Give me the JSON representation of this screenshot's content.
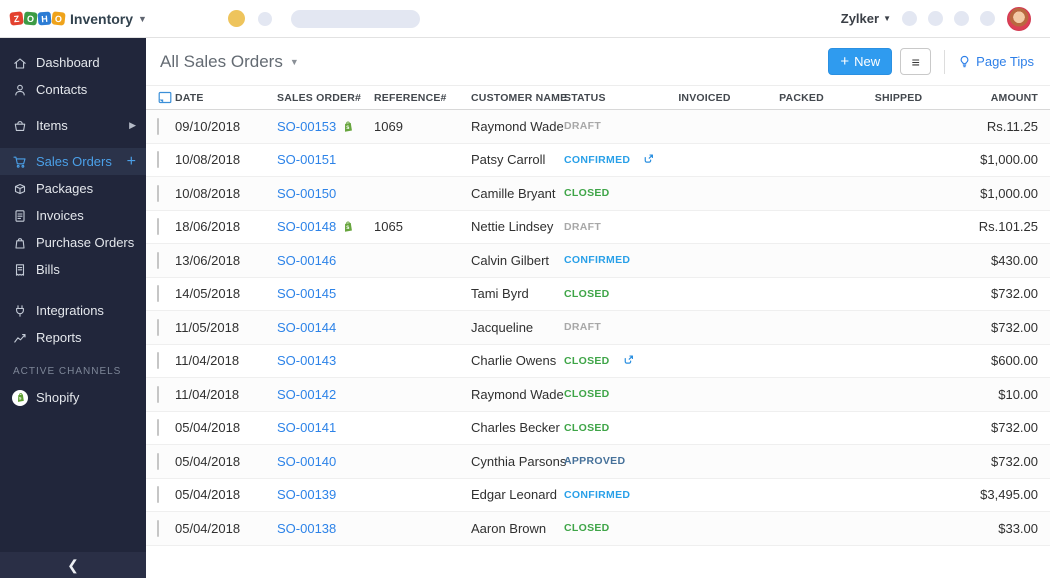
{
  "topbar": {
    "logo_letters": [
      "Z",
      "O",
      "H",
      "O"
    ],
    "logo_colors": [
      "#E3412F",
      "#3D9B45",
      "#2C7CD4",
      "#EFA31B"
    ],
    "product_name": "Inventory",
    "org_name": "Zylker"
  },
  "sidebar": {
    "items": [
      {
        "label": "Dashboard"
      },
      {
        "label": "Contacts"
      },
      {
        "label": "Items"
      },
      {
        "label": "Sales Orders"
      },
      {
        "label": "Packages"
      },
      {
        "label": "Invoices"
      },
      {
        "label": "Purchase Orders"
      },
      {
        "label": "Bills"
      },
      {
        "label": "Integrations"
      },
      {
        "label": "Reports"
      }
    ],
    "section_label": "ACTIVE CHANNELS",
    "channels": [
      {
        "label": "Shopify"
      }
    ]
  },
  "header": {
    "title": "All Sales Orders",
    "new_plus": "+",
    "new_label": "New",
    "menu_icon": "≡",
    "page_tips": "Page Tips"
  },
  "table": {
    "columns": [
      "DATE",
      "SALES ORDER#",
      "REFERENCE#",
      "CUSTOMER NAME",
      "STATUS",
      "INVOICED",
      "PACKED",
      "SHIPPED",
      "AMOUNT"
    ],
    "status_colors": {
      "DRAFT": "#a8a8a8",
      "CONFIRMED": "#29a0e8",
      "CLOSED": "#3fa548",
      "APPROVED": "#46719a"
    },
    "dot_colors": {
      "empty": "#e9e9e9",
      "blue": "#2196f3",
      "green": "#4caf50"
    },
    "rows": [
      {
        "date": "09/10/2018",
        "order_no": "SO-00153",
        "channel_badge": true,
        "reference": "1069",
        "customer": "Raymond Wade",
        "status": "DRAFT",
        "status_icon": false,
        "invoiced": "empty",
        "packed": "empty",
        "shipped": "empty",
        "amount": "Rs.11.25"
      },
      {
        "date": "10/08/2018",
        "order_no": "SO-00151",
        "channel_badge": false,
        "reference": "",
        "customer": "Patsy Carroll",
        "status": "CONFIRMED",
        "status_icon": true,
        "invoiced": "empty",
        "packed": "blue",
        "shipped": "blue",
        "amount": "$1,000.00"
      },
      {
        "date": "10/08/2018",
        "order_no": "SO-00150",
        "channel_badge": false,
        "reference": "",
        "customer": "Camille Bryant",
        "status": "CLOSED",
        "status_icon": false,
        "invoiced": "blue",
        "packed": "empty",
        "shipped": "empty",
        "amount": "$1,000.00"
      },
      {
        "date": "18/06/2018",
        "order_no": "SO-00148",
        "channel_badge": true,
        "reference": "1065",
        "customer": "Nettie Lindsey",
        "status": "DRAFT",
        "status_icon": false,
        "invoiced": "empty",
        "packed": "empty",
        "shipped": "empty",
        "amount": "Rs.101.25"
      },
      {
        "date": "13/06/2018",
        "order_no": "SO-00146",
        "channel_badge": false,
        "reference": "",
        "customer": "Calvin Gilbert",
        "status": "CONFIRMED",
        "status_icon": false,
        "invoiced": "empty",
        "packed": "empty",
        "shipped": "empty",
        "amount": "$430.00"
      },
      {
        "date": "14/05/2018",
        "order_no": "SO-00145",
        "channel_badge": false,
        "reference": "",
        "customer": "Tami Byrd",
        "status": "CLOSED",
        "status_icon": false,
        "invoiced": "blue",
        "packed": "blue",
        "shipped": "green",
        "amount": "$732.00"
      },
      {
        "date": "11/05/2018",
        "order_no": "SO-00144",
        "channel_badge": false,
        "reference": "",
        "customer": "Jacqueline",
        "status": "DRAFT",
        "status_icon": false,
        "invoiced": "empty",
        "packed": "empty",
        "shipped": "empty",
        "amount": "$732.00"
      },
      {
        "date": "11/04/2018",
        "order_no": "SO-00143",
        "channel_badge": false,
        "reference": "",
        "customer": "Charlie Owens",
        "status": "CLOSED",
        "status_icon": true,
        "invoiced": "blue",
        "packed": "blue",
        "shipped": "green",
        "amount": "$600.00"
      },
      {
        "date": "11/04/2018",
        "order_no": "SO-00142",
        "channel_badge": false,
        "reference": "",
        "customer": "Raymond Wade",
        "status": "CLOSED",
        "status_icon": false,
        "invoiced": "blue",
        "packed": "empty",
        "shipped": "empty",
        "amount": "$10.00"
      },
      {
        "date": "05/04/2018",
        "order_no": "SO-00141",
        "channel_badge": false,
        "reference": "",
        "customer": "Charles Becker",
        "status": "CLOSED",
        "status_icon": false,
        "invoiced": "blue",
        "packed": "blue",
        "shipped": "green",
        "amount": "$732.00"
      },
      {
        "date": "05/04/2018",
        "order_no": "SO-00140",
        "channel_badge": false,
        "reference": "",
        "customer": "Cynthia Parsons",
        "status": "APPROVED",
        "status_icon": false,
        "invoiced": "empty",
        "packed": "empty",
        "shipped": "empty",
        "amount": "$732.00"
      },
      {
        "date": "05/04/2018",
        "order_no": "SO-00139",
        "channel_badge": false,
        "reference": "",
        "customer": "Edgar Leonard",
        "status": "CONFIRMED",
        "status_icon": false,
        "invoiced": "half",
        "packed": "blue",
        "shipped": "blue",
        "amount": "$3,495.00"
      },
      {
        "date": "05/04/2018",
        "order_no": "SO-00138",
        "channel_badge": false,
        "reference": "",
        "customer": "Aaron Brown",
        "status": "CLOSED",
        "status_icon": false,
        "invoiced": "blue",
        "packed": "blue",
        "shipped": "green",
        "amount": "$33.00"
      }
    ]
  }
}
